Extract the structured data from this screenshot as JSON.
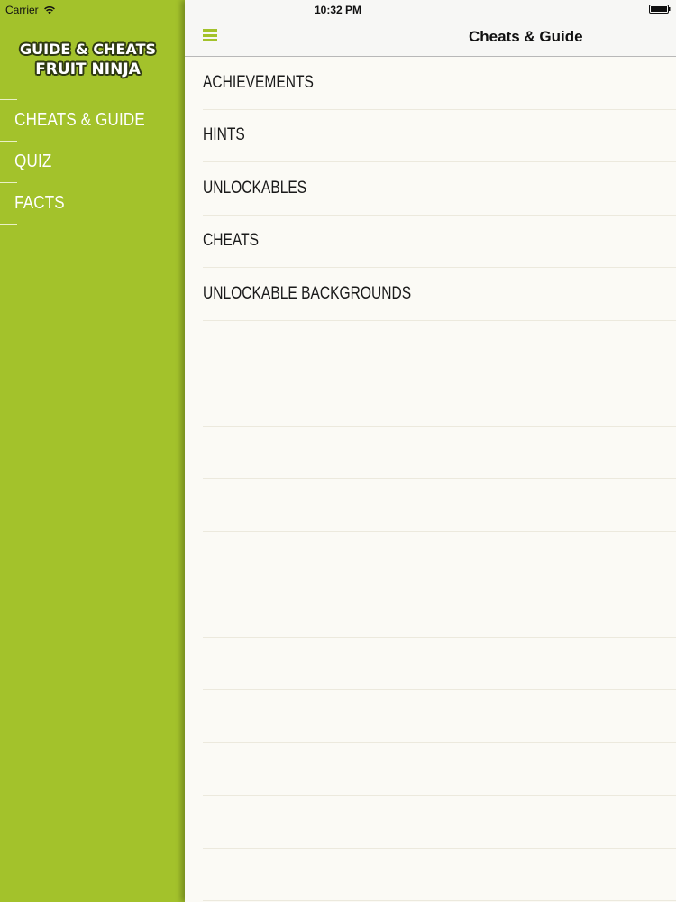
{
  "status_bar": {
    "carrier": "Carrier",
    "time": "10:32 PM"
  },
  "sidebar": {
    "logo": {
      "line1": "GUIDE & CHEATS",
      "line2": "FRUIT NINJA"
    },
    "items": [
      {
        "label": "CHEATS & GUIDE"
      },
      {
        "label": "QUIZ"
      },
      {
        "label": "FACTS"
      }
    ]
  },
  "header": {
    "title": "Cheats & Guide"
  },
  "list": {
    "rows": [
      {
        "label": "ACHIEVEMENTS"
      },
      {
        "label": "HINTS"
      },
      {
        "label": "UNLOCKABLES"
      },
      {
        "label": "CHEATS"
      },
      {
        "label": "UNLOCKABLE BACKGROUNDS"
      },
      {
        "label": ""
      },
      {
        "label": ""
      },
      {
        "label": ""
      },
      {
        "label": ""
      },
      {
        "label": ""
      },
      {
        "label": ""
      },
      {
        "label": ""
      },
      {
        "label": ""
      },
      {
        "label": ""
      },
      {
        "label": ""
      },
      {
        "label": ""
      }
    ]
  },
  "colors": {
    "accent": "#a3c22b",
    "panel_bg": "#fbfaf5"
  },
  "icons": {
    "menu": "hamburger-menu-icon",
    "wifi": "wifi-icon",
    "battery": "battery-icon"
  }
}
